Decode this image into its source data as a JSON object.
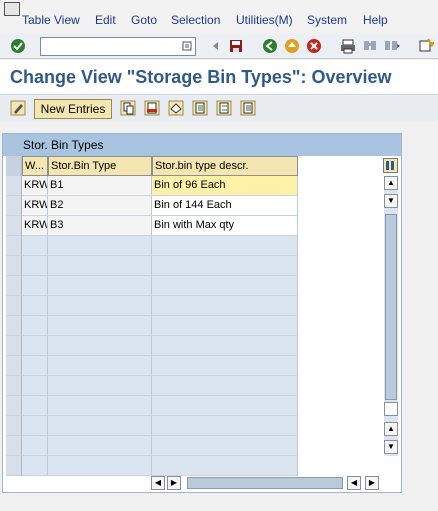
{
  "menubar": {
    "items": [
      {
        "label": "Table View",
        "underline": "T"
      },
      {
        "label": "Edit",
        "underline": "E"
      },
      {
        "label": "Goto",
        "underline": "G"
      },
      {
        "label": "Selection",
        "underline": "S"
      },
      {
        "label": "Utilities(M)",
        "underline": "U"
      },
      {
        "label": "System",
        "underline": "y"
      },
      {
        "label": "Help",
        "underline": "H"
      }
    ]
  },
  "toolbar": {
    "command_value": "",
    "icons": [
      "enter-icon",
      "command-dropdown-icon",
      "back-arrow-small-icon",
      "save-icon",
      "back-icon",
      "exit-icon",
      "cancel-icon",
      "print-icon",
      "find-icon",
      "find-next-icon",
      "new-session-icon"
    ]
  },
  "title": "Change View \"Storage Bin Types\": Overview",
  "apptoolbar": {
    "new_entries_label": "New Entries",
    "icons": [
      "display-change-icon",
      "copy-as-icon",
      "delete-icon",
      "undo-change-icon",
      "select-all-icon",
      "select-block-icon",
      "deselect-all-icon"
    ]
  },
  "table": {
    "title": "Stor. Bin Types",
    "columns": [
      "W...",
      "Stor.Bin Type",
      "Stor.bin type descr."
    ],
    "rows": [
      {
        "w": "KRW",
        "type": "B1",
        "descr": "Bin of 96 Each"
      },
      {
        "w": "KRW",
        "type": "B2",
        "descr": "Bin of 144 Each"
      },
      {
        "w": "KRW",
        "type": "B3",
        "descr": "Bin with Max qty"
      }
    ],
    "empty_rows": 12,
    "highlight_color": "#fff2a8"
  }
}
